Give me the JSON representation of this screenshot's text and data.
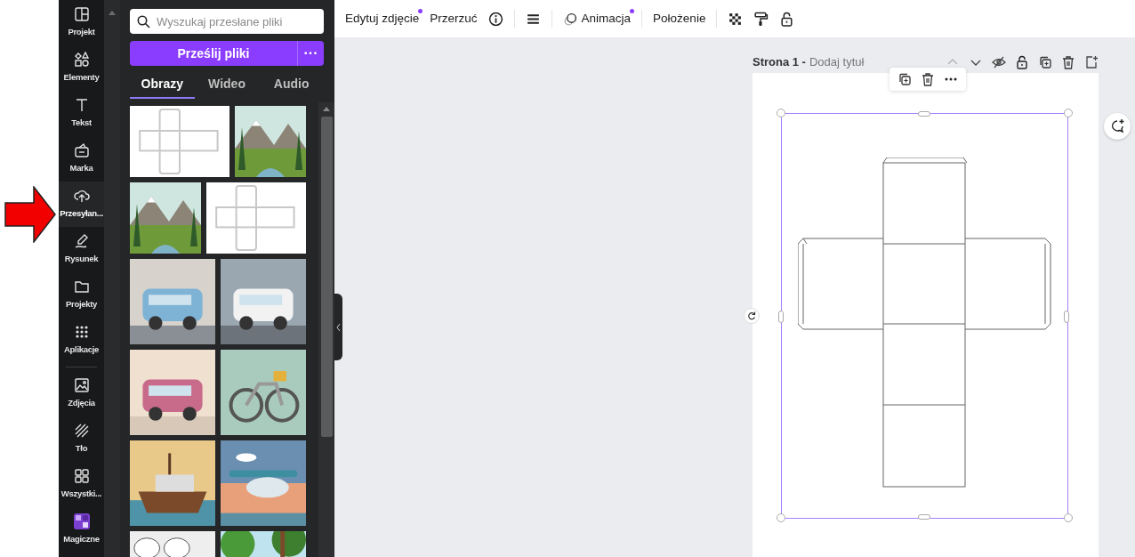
{
  "sidebar": {
    "items": [
      {
        "label": "Projekt",
        "selected": false
      },
      {
        "label": "Elementy",
        "selected": false
      },
      {
        "label": "Tekst",
        "selected": false
      },
      {
        "label": "Marka",
        "selected": false
      },
      {
        "label": "Przesyłan...",
        "selected": true
      },
      {
        "label": "Rysunek",
        "selected": false
      },
      {
        "label": "Projekty",
        "selected": false
      },
      {
        "label": "Aplikacje",
        "selected": false
      },
      {
        "label": "Zdjęcia",
        "selected": false
      },
      {
        "label": "Tło",
        "selected": false
      },
      {
        "label": "Wszystki...",
        "selected": false
      },
      {
        "label": "Magiczne",
        "selected": false
      }
    ]
  },
  "panel": {
    "search": {
      "placeholder": "Wyszukaj przesłane pliki"
    },
    "upload_button": "Prześlij pliki",
    "more_button": "···",
    "tabs": [
      {
        "label": "Obrazy",
        "selected": true
      },
      {
        "label": "Wideo",
        "selected": false
      },
      {
        "label": "Audio",
        "selected": false
      }
    ]
  },
  "toolbar": {
    "items": [
      {
        "kind": "text",
        "label": "Edytuj zdjęcie",
        "dot": true
      },
      {
        "kind": "text",
        "label": "Przerzuć",
        "dot": false
      },
      {
        "kind": "icon"
      },
      {
        "kind": "divider"
      },
      {
        "kind": "icon"
      },
      {
        "kind": "divider"
      },
      {
        "kind": "text",
        "label": "Animacja",
        "dot": true
      },
      {
        "kind": "divider"
      },
      {
        "kind": "text",
        "label": "Położenie",
        "dot": false
      },
      {
        "kind": "divider"
      },
      {
        "kind": "icon"
      },
      {
        "kind": "icon"
      },
      {
        "kind": "icon"
      }
    ]
  },
  "page": {
    "label": "Strona 1 -",
    "title_placeholder": "Dodaj tytuł",
    "actions": [
      {
        "disabled": true
      },
      {
        "disabled": false
      },
      {
        "disabled": false
      },
      {
        "disabled": false
      },
      {
        "disabled": false
      },
      {
        "disabled": false
      },
      {
        "disabled": false
      }
    ]
  }
}
